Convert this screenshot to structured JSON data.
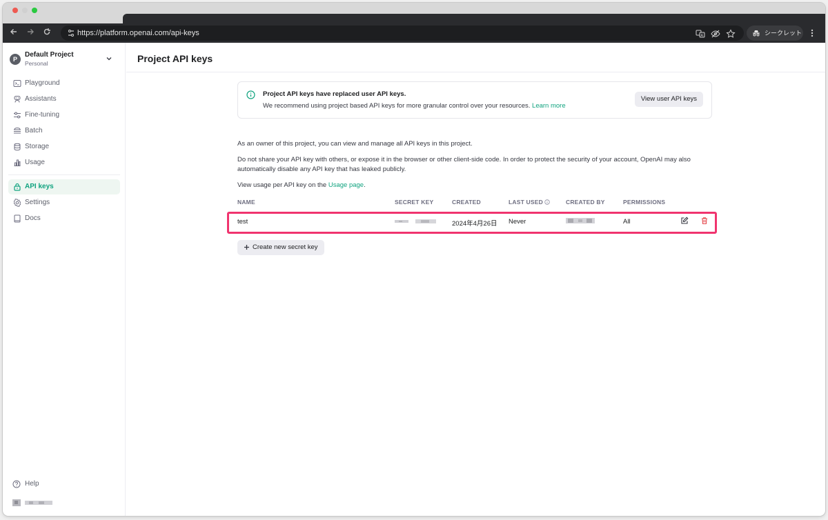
{
  "browser": {
    "url": "https://platform.openai.com/api-keys",
    "incognito_label": "シークレット"
  },
  "sidebar": {
    "project": {
      "avatar_letter": "P",
      "name": "Default Project",
      "subtitle": "Personal"
    },
    "items": [
      {
        "label": "Playground",
        "icon": "terminal-icon"
      },
      {
        "label": "Assistants",
        "icon": "robot-icon"
      },
      {
        "label": "Fine-tuning",
        "icon": "sliders-icon"
      },
      {
        "label": "Batch",
        "icon": "layers-icon"
      },
      {
        "label": "Storage",
        "icon": "database-icon"
      },
      {
        "label": "Usage",
        "icon": "bar-chart-icon"
      }
    ],
    "items2": [
      {
        "label": "API keys",
        "icon": "lock-icon",
        "active": true
      },
      {
        "label": "Settings",
        "icon": "gear-icon"
      },
      {
        "label": "Docs",
        "icon": "book-icon"
      }
    ],
    "help_label": "Help"
  },
  "main": {
    "title": "Project API keys",
    "banner": {
      "title": "Project API keys have replaced user API keys.",
      "text": "We recommend using project based API keys for more granular control over your resources.",
      "link": "Learn more",
      "button": "View user API keys"
    },
    "para1": "As an owner of this project, you can view and manage all API keys in this project.",
    "para2": "Do not share your API key with others, or expose it in the browser or other client-side code. In order to protect the security of your account, OpenAI may also automatically disable any API key that has leaked publicly.",
    "para3_prefix": "View usage per API key on the ",
    "para3_link": "Usage page",
    "para3_suffix": ".",
    "table": {
      "headers": [
        "NAME",
        "SECRET KEY",
        "CREATED",
        "LAST USED",
        "CREATED BY",
        "PERMISSIONS"
      ],
      "rows": [
        {
          "name": "test",
          "created": "2024年4月26日",
          "last_used": "Never",
          "permissions": "All"
        }
      ]
    },
    "create_button": "Create new secret key"
  },
  "colors": {
    "accent": "#10a37f",
    "highlight": "#f0346e",
    "danger": "#e5484d"
  }
}
